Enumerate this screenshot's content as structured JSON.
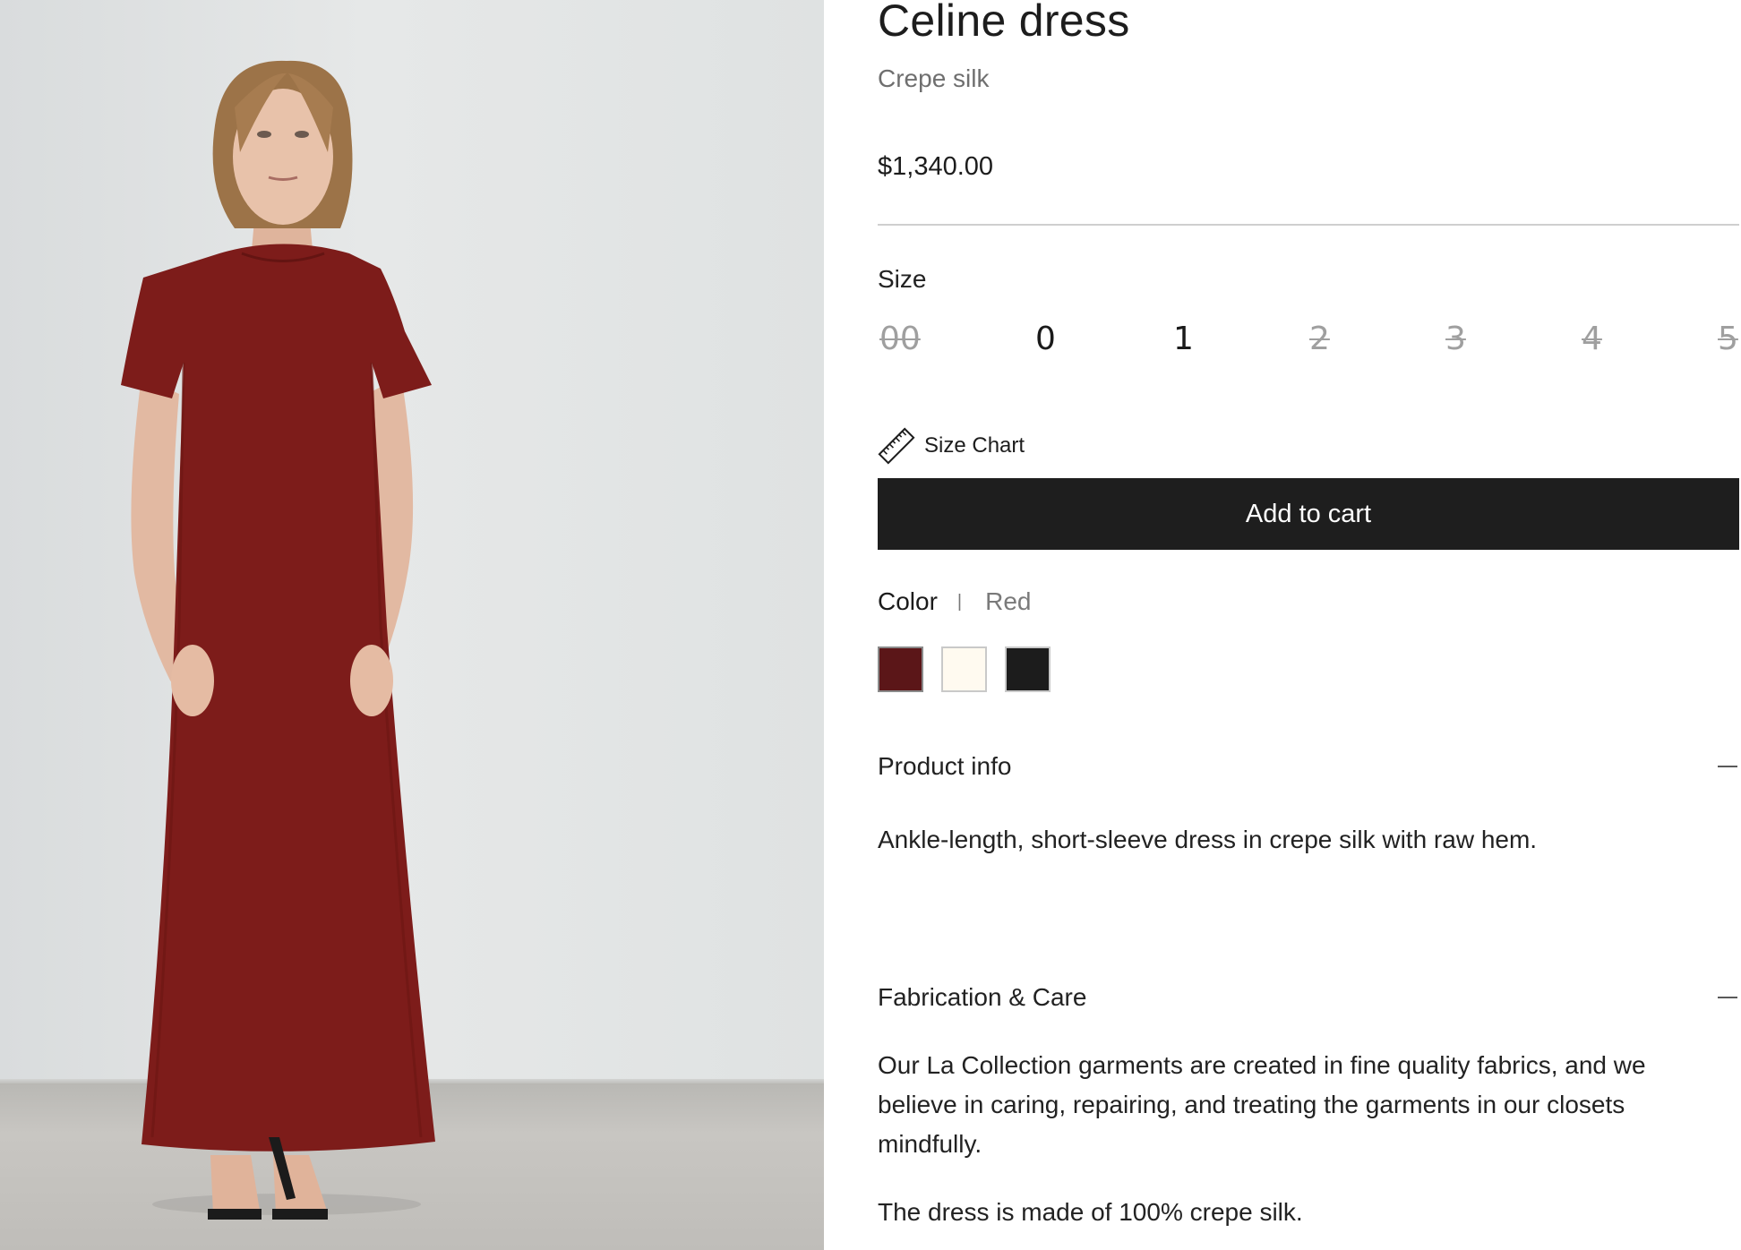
{
  "product": {
    "name": "Celine dress",
    "material": "Crepe silk",
    "price": "$1,340.00"
  },
  "size": {
    "label": "Size",
    "options": [
      {
        "value": "00",
        "available": false
      },
      {
        "value": "0",
        "available": true
      },
      {
        "value": "1",
        "available": true
      },
      {
        "value": "2",
        "available": false
      },
      {
        "value": "3",
        "available": false
      },
      {
        "value": "4",
        "available": false
      },
      {
        "value": "5",
        "available": false
      }
    ],
    "chart_label": "Size Chart",
    "chart_icon": "ruler-icon"
  },
  "cart": {
    "label": "Add to cart"
  },
  "color": {
    "label": "Color",
    "separator": "|",
    "selected": "Red",
    "swatches": [
      {
        "name": "red",
        "hex": "#5b1618"
      },
      {
        "name": "cream",
        "hex": "#fffaf0"
      },
      {
        "name": "black",
        "hex": "#1c1c1c"
      }
    ]
  },
  "sections": [
    {
      "title": "Product info",
      "expanded": true,
      "paragraphs": [
        "Ankle-length, short-sleeve dress in crepe silk with raw hem."
      ]
    },
    {
      "title": "Fabrication & Care",
      "expanded": true,
      "paragraphs": [
        "Our La Collection garments are created in fine quality fabrics, and we believe in caring, repairing, and treating the garments in our closets mindfully.",
        "The dress is made of 100% crepe silk."
      ]
    }
  ],
  "image": {
    "dress_color": "#7d1c1a",
    "backdrop": "#e2e5e5"
  }
}
